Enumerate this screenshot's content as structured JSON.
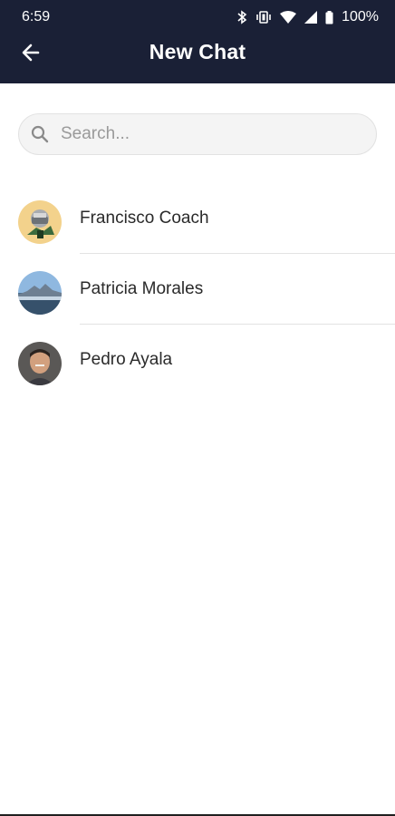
{
  "status_bar": {
    "time": "6:59",
    "battery": "100%",
    "icons": [
      "bluetooth-icon",
      "vibrate-icon",
      "wifi-icon",
      "signal-icon",
      "battery-icon"
    ]
  },
  "header": {
    "title": "New Chat",
    "back_icon": "arrow-left-icon"
  },
  "search": {
    "placeholder": "Search...",
    "value": "",
    "icon": "search-icon"
  },
  "contacts": [
    {
      "name": "Francisco Coach",
      "avatar": "avatar-francisco"
    },
    {
      "name": "Patricia Morales",
      "avatar": "avatar-patricia"
    },
    {
      "name": "Pedro Ayala",
      "avatar": "avatar-pedro"
    }
  ],
  "colors": {
    "appbar_bg": "#1a2036",
    "text_primary": "#2a2a2a",
    "divider": "#e3e3e3",
    "search_bg": "#f4f4f4"
  }
}
